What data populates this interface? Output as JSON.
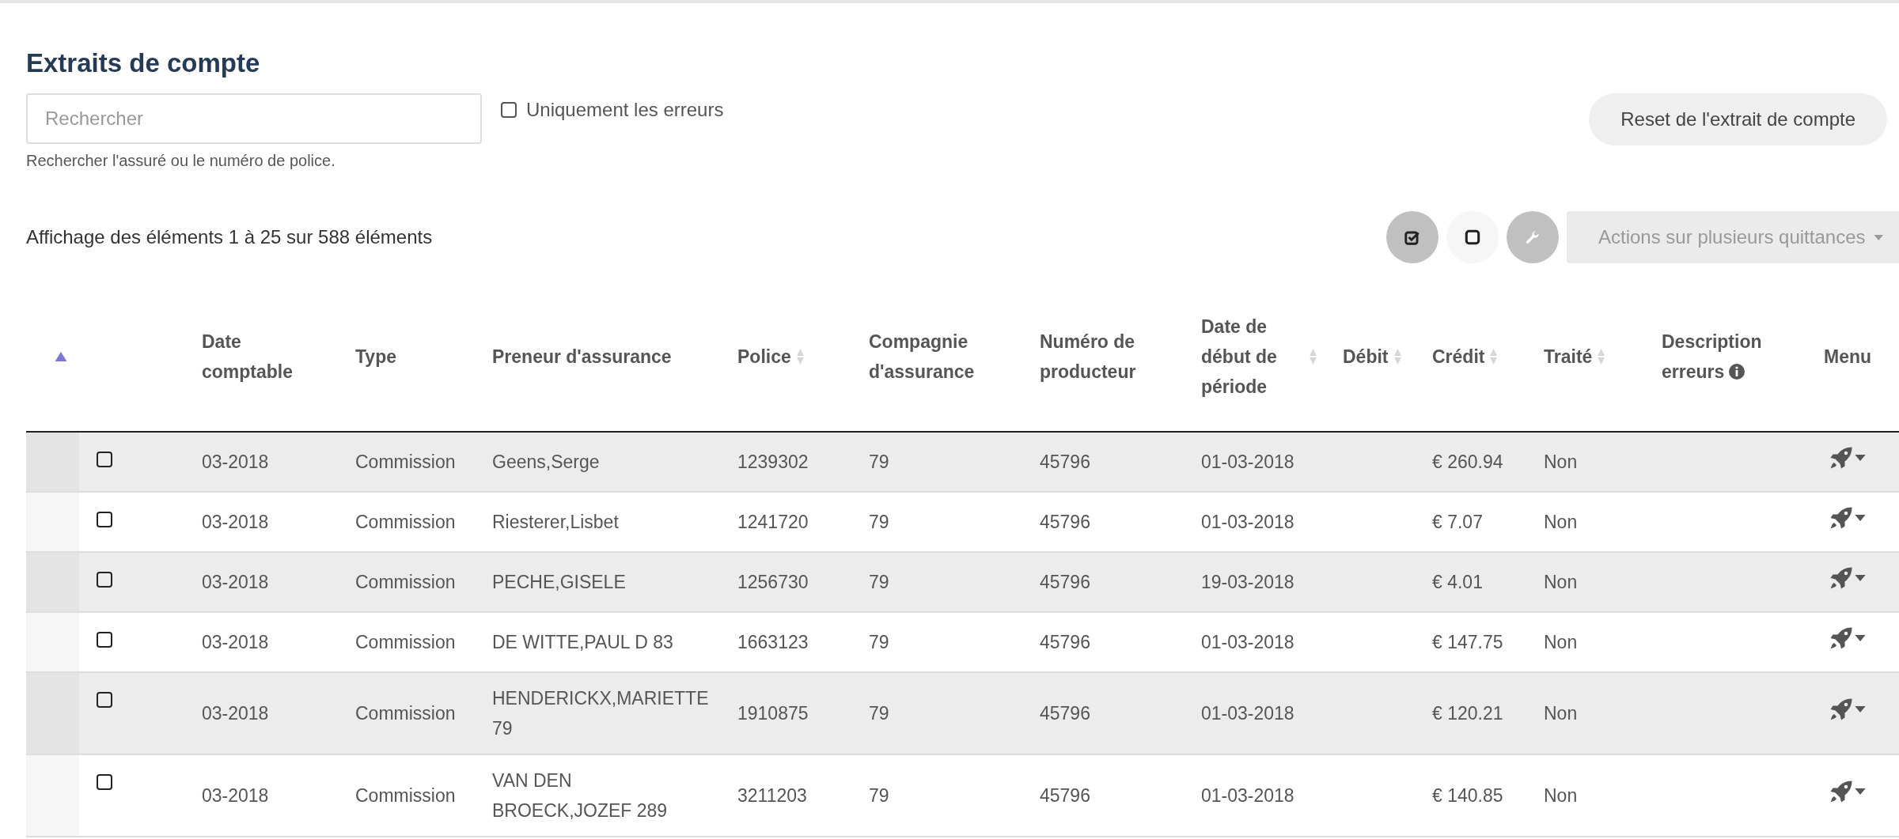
{
  "title": "Extraits de compte",
  "search": {
    "placeholder": "Rechercher",
    "hint": "Rechercher l'assuré ou le numéro de police."
  },
  "errors_only": {
    "label": "Uniquement les erreurs",
    "checked": false
  },
  "reset_button": "Reset de l'extrait de compte",
  "count_text": "Affichage des éléments 1 à 25 sur 588 éléments",
  "toolbar": [
    {
      "kind": "check-all",
      "selected": true
    },
    {
      "kind": "uncheck-all",
      "selected": false
    },
    {
      "kind": "wrench",
      "selected": true
    }
  ],
  "bulk_actions": {
    "label": "Actions sur plusieurs quittances",
    "disabled": true
  },
  "table": {
    "columns": [
      {
        "sortable": true,
        "sorted_ascending": true
      },
      {},
      {
        "label": "Date comptable"
      },
      {
        "label": "Type"
      },
      {
        "label": "Preneur d'assurance"
      },
      {
        "label": "Police",
        "sortable": true,
        "sorted_ascending": false
      },
      {
        "label": "Compagnie d'assurance"
      },
      {
        "label": "Numéro de producteur"
      },
      {
        "label": "Date de début de période",
        "sortable": true,
        "sorted_ascending": false
      },
      {
        "label": "Débit",
        "sortable": true,
        "sorted_ascending": false
      },
      {
        "label": "Crédit",
        "sortable": true,
        "sorted_ascending": false
      },
      {
        "label": "Traité",
        "sortable": true,
        "sorted_ascending": false
      },
      {
        "label": "Description erreurs",
        "info": true
      },
      {
        "label": "Menu"
      }
    ],
    "rows": [
      {
        "checked": false,
        "cells": [
          "",
          "",
          "03-2018",
          "Commission",
          "Geens,Serge",
          "1239302",
          "79",
          "45796",
          "01-03-2018",
          "",
          "€ 260.94",
          "Non",
          "",
          ""
        ]
      },
      {
        "checked": false,
        "cells": [
          "",
          "",
          "03-2018",
          "Commission",
          "Riesterer,Lisbet",
          "1241720",
          "79",
          "45796",
          "01-03-2018",
          "",
          "€ 7.07",
          "Non",
          "",
          ""
        ]
      },
      {
        "checked": false,
        "cells": [
          "",
          "",
          "03-2018",
          "Commission",
          "PECHE,GISELE",
          "1256730",
          "79",
          "45796",
          "19-03-2018",
          "",
          "€ 4.01",
          "Non",
          "",
          ""
        ]
      },
      {
        "checked": false,
        "cells": [
          "",
          "",
          "03-2018",
          "Commission",
          "DE WITTE,PAUL D 83",
          "1663123",
          "79",
          "45796",
          "01-03-2018",
          "",
          "€ 147.75",
          "Non",
          "",
          ""
        ]
      },
      {
        "checked": false,
        "cells": [
          "",
          "",
          "03-2018",
          "Commission",
          "HENDERICKX,MARIETTE 79",
          "1910875",
          "79",
          "45796",
          "01-03-2018",
          "",
          "€ 120.21",
          "Non",
          "",
          ""
        ]
      },
      {
        "checked": false,
        "cells": [
          "",
          "",
          "03-2018",
          "Commission",
          "VAN DEN BROECK,JOZEF 289",
          "3211203",
          "79",
          "45796",
          "01-03-2018",
          "",
          "€ 140.85",
          "Non",
          "",
          ""
        ]
      }
    ]
  }
}
